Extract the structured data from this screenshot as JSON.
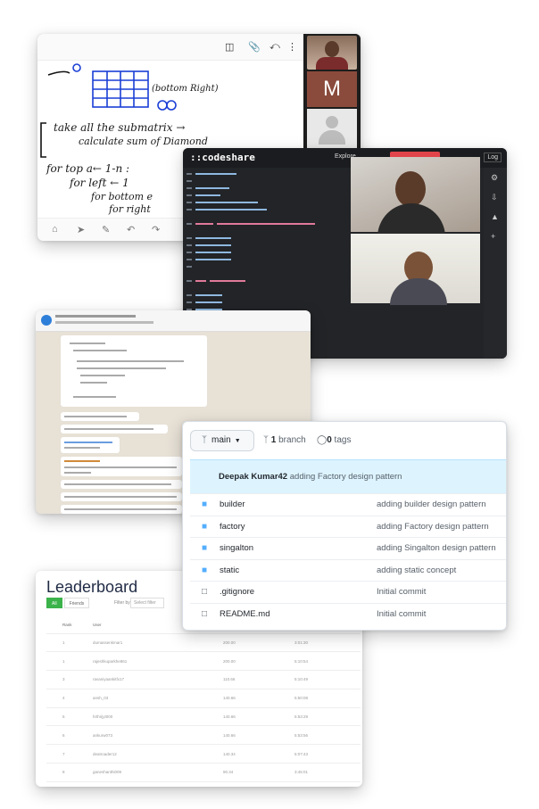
{
  "colors": {
    "github_folder": "#54aeff",
    "github_commit_bg": "#ddf4ff",
    "leaderboard_active_tab": "#3bb34a",
    "codeshare_bg": "#222427",
    "codeshare_action": "#e2444b"
  },
  "whiteboard": {
    "participant_letter": "M",
    "toolbar_icons": [
      "split-view-icon",
      "attach-icon",
      "share-icon",
      "more-vertical-icon"
    ],
    "bottom_icons": [
      "home-icon",
      "pointer-icon",
      "pen-icon",
      "undo-icon",
      "redo-icon"
    ],
    "ink": [
      "(bottom Right)",
      "take all the submatrix →",
      "calculate sum of Diamond",
      "for top a← 1-n :",
      "for left ← 1",
      "for bottom e",
      "for right"
    ]
  },
  "codeshare": {
    "logo": "::codeshare",
    "explore": "Explore",
    "login": "Log"
  },
  "github": {
    "branch": "main",
    "branches_count": "1",
    "branches_label": "branch",
    "tags_count": "0",
    "tags_label": "tags",
    "last_commit_author": "Deepak Kumar42",
    "last_commit_message": "adding Factory design pattern",
    "files": [
      {
        "type": "folder",
        "name": "builder",
        "message": "adding builder design pattern"
      },
      {
        "type": "folder",
        "name": "factory",
        "message": "adding Factory design pattern"
      },
      {
        "type": "folder",
        "name": "singalton",
        "message": "adding Singalton design pattern"
      },
      {
        "type": "folder",
        "name": "static",
        "message": "adding static concept"
      },
      {
        "type": "file",
        "name": ".gitignore",
        "message": "Initial commit"
      },
      {
        "type": "file",
        "name": "README.md",
        "message": "Initial commit"
      }
    ]
  },
  "leaderboard": {
    "title": "Leaderboard",
    "tabs": [
      "All",
      "Friends"
    ],
    "filter_label": "Filter by",
    "filter_placeholder": "Select filter",
    "columns": [
      "Rank",
      "User",
      "",
      ""
    ],
    "rows": [
      {
        "rank": "1",
        "user": "dumassenkmar1",
        "score": "200.00",
        "time": "3:01:30"
      },
      {
        "rank": "1",
        "user": "rajeshkuparkhe861",
        "score": "200.00",
        "time": "5:10:54"
      },
      {
        "rank": "3",
        "user": "ravaniyaankitfx17",
        "score": "110.66",
        "time": "5:10:49"
      },
      {
        "rank": "4",
        "user": "ansh_03",
        "score": "140.66",
        "time": "5:50:08"
      },
      {
        "rank": "5",
        "user": "hrthrijyt000",
        "score": "140.66",
        "time": "5:53:29"
      },
      {
        "rank": "6",
        "user": "ankurw073",
        "score": "140.66",
        "time": "5:53:56"
      },
      {
        "rank": "7",
        "user": "deatroader12",
        "score": "140.34",
        "time": "5:07:43"
      },
      {
        "rank": "8",
        "user": "ganeshanthi009",
        "score": "90.34",
        "time": "3:45:01"
      }
    ]
  }
}
